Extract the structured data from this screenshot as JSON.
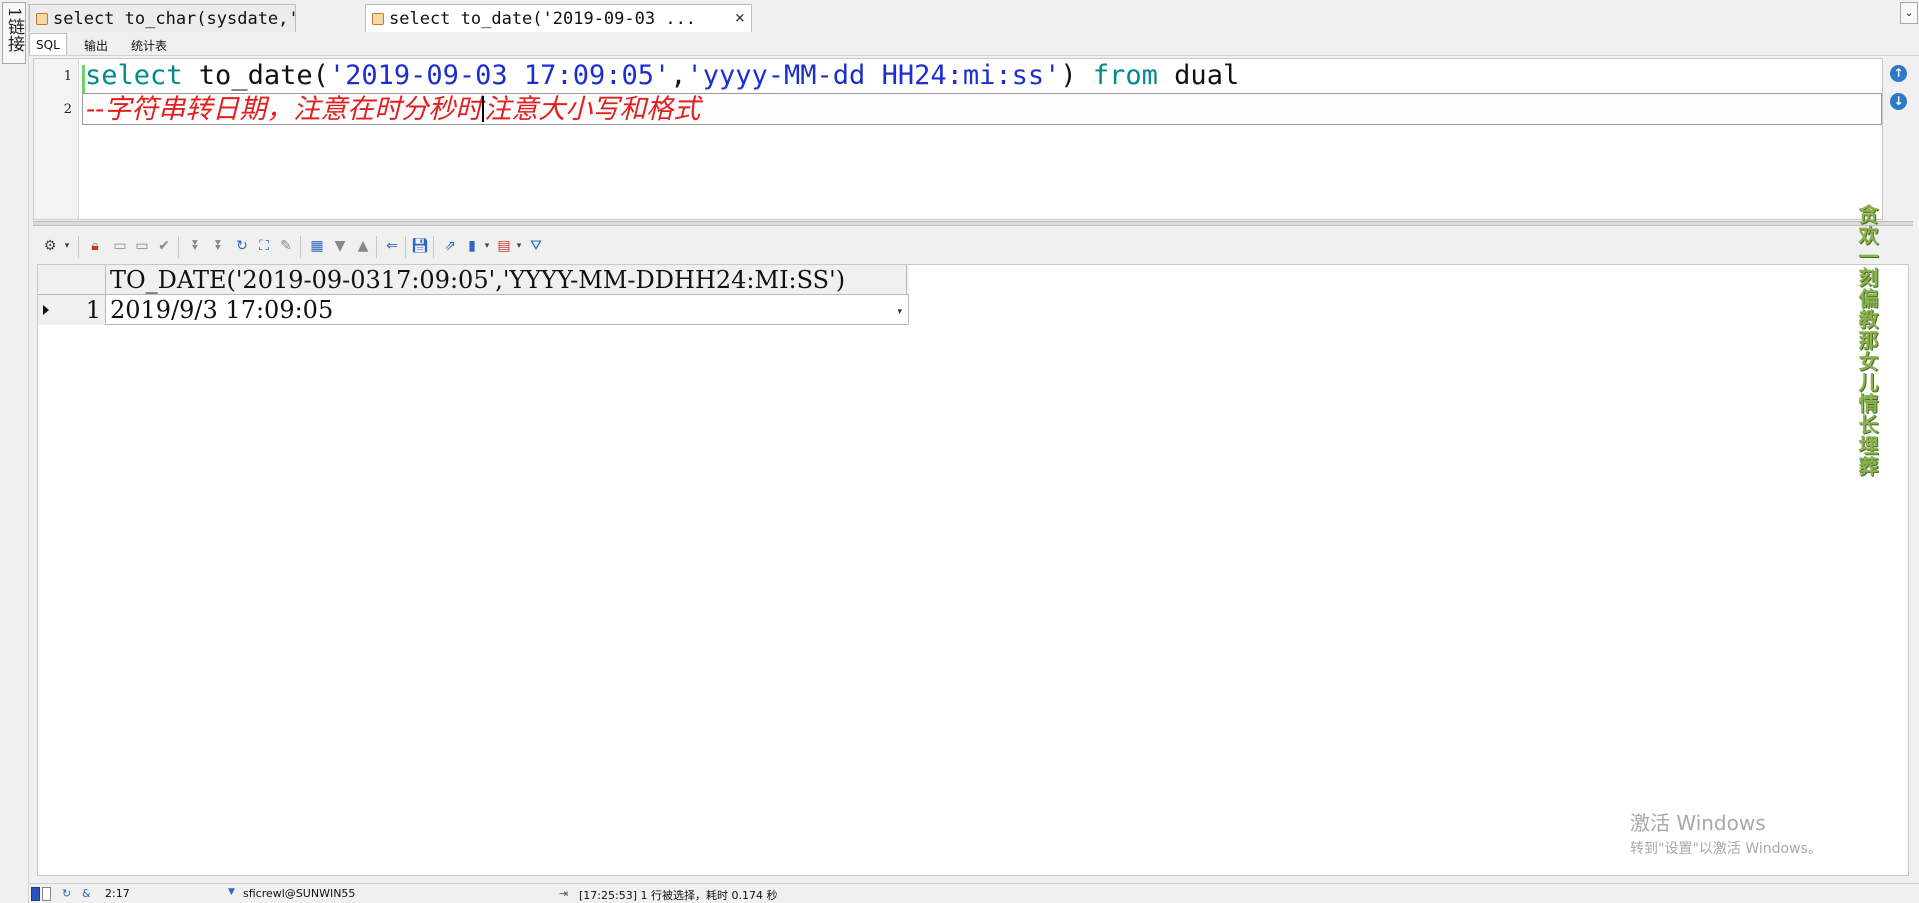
{
  "left_strip": {
    "connection_tab": "1链接"
  },
  "tabs": [
    {
      "label": "select to_char(sysdate,'yy ...",
      "active": false
    },
    {
      "label": "select to_date('2019-09-03 ...",
      "active": true,
      "close": "×"
    }
  ],
  "tab_scroll": "⌄",
  "subtabs": [
    "SQL",
    "输出",
    "统计表"
  ],
  "editor": {
    "line_numbers": [
      "1",
      "2"
    ],
    "line1": {
      "kw_select": "select",
      "fn": " to_date(",
      "str1": "'2019-09-03 17:09:05'",
      "comma": ",",
      "str2": "'yyyy-MM-dd HH24:mi:ss'",
      "paren": ") ",
      "kw_from": "from",
      "table": " dual"
    },
    "line2": {
      "comment_before_caret": "--字符串转日期，注意在时分秒时",
      "comment_after_caret": "注意大小写和格式"
    }
  },
  "toolbar_icons": [
    "grid-options-icon",
    "lock-icon",
    "new-row-icon",
    "delete-row-icon",
    "post-changes-icon",
    "fetch-next-icon",
    "fetch-last-icon",
    "refresh-icon",
    "find-icon",
    "clear-icon",
    "single-record-icon",
    "next-record-icon",
    "prev-record-icon",
    "query-by-example-icon",
    "save-icon",
    "export-icon",
    "chart-icon",
    "grid-view-icon",
    "filter-icon"
  ],
  "grid": {
    "column_header": "TO_DATE('2019-09-0317:09:05','YYYY-MM-DDHH24:MI:SS')",
    "rows": [
      {
        "num": "1",
        "value": "2019/9/3 17:09:05"
      }
    ]
  },
  "watermark": {
    "title": "激活 Windows",
    "subtitle": "转到\"设置\"以激活 Windows。"
  },
  "side_watermark": "贪欢一刻偏教那女儿情长埋葬",
  "statusbar": {
    "position": "2:17",
    "connection": "sficrewl@SUNWIN55",
    "message": "[17:25:53]  1 行被选择，耗时 0.174 秒"
  }
}
